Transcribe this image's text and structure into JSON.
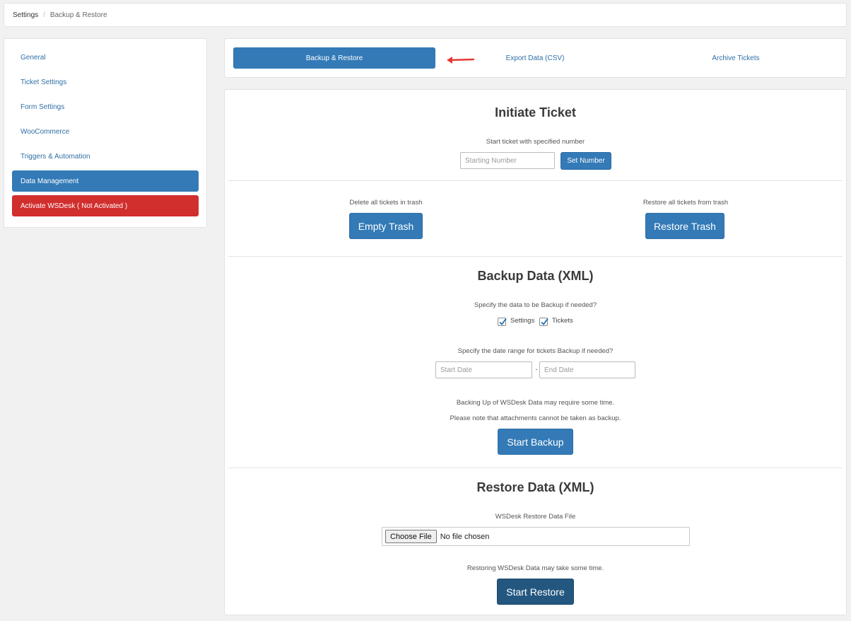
{
  "breadcrumb": {
    "root": "Settings",
    "separator": "/",
    "current": "Backup & Restore"
  },
  "sidebar": {
    "items": [
      {
        "label": "General"
      },
      {
        "label": "Ticket Settings"
      },
      {
        "label": "Form Settings"
      },
      {
        "label": "WooCommerce"
      },
      {
        "label": "Triggers & Automation"
      },
      {
        "label": "Data Management",
        "state": "active"
      },
      {
        "label": "Activate WSDesk ( Not Activated )",
        "state": "danger"
      }
    ]
  },
  "tabs": [
    {
      "label": "Backup & Restore",
      "active": true
    },
    {
      "label": "Export Data (CSV)"
    },
    {
      "label": "Archive Tickets"
    }
  ],
  "initiate_ticket": {
    "title": "Initiate Ticket",
    "description": "Start ticket with specified number",
    "input_placeholder": "Starting Number",
    "button_label": "Set Number"
  },
  "trash": {
    "empty_description": "Delete all tickets in trash",
    "empty_button": "Empty Trash",
    "restore_description": "Restore all tickets from trash",
    "restore_button": "Restore Trash"
  },
  "backup": {
    "title": "Backup Data (XML)",
    "specify_text": "Specify the data to be Backup if needed?",
    "options": [
      {
        "label": "Settings",
        "checked": true
      },
      {
        "label": "Tickets",
        "checked": true
      }
    ],
    "date_range_text": "Specify the date range for tickets Backup if needed?",
    "start_placeholder": "Start Date",
    "range_separator": "-",
    "end_placeholder": "End Date",
    "note_1": "Backing Up of WSDesk Data may require some time.",
    "note_2": "Please note that attachments cannot be taken as backup.",
    "button_label": "Start Backup"
  },
  "restore": {
    "title": "Restore Data (XML)",
    "file_label": "WSDesk Restore Data File",
    "choose_file": "Choose File",
    "file_status": "No file chosen",
    "note": "Restoring WSDesk Data may take some time.",
    "button_label": "Start Restore"
  },
  "colors": {
    "primary": "#337ab7",
    "danger": "#d12e2e",
    "arrow": "#e53935",
    "restore_button": "#24577f"
  }
}
